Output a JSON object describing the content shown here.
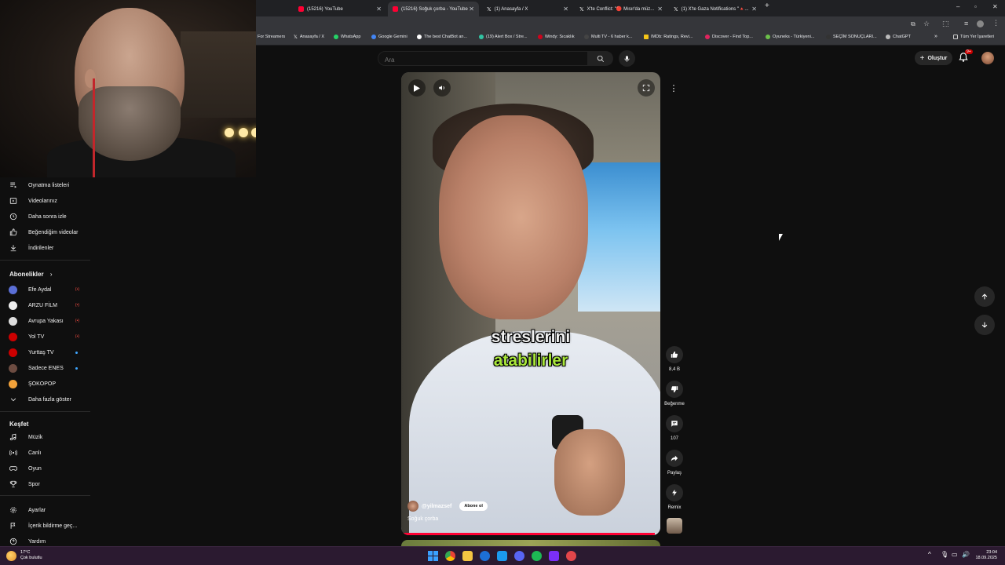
{
  "browser": {
    "tabs": [
      {
        "title": "(15216) YouTube",
        "active": false,
        "fav_color": "#ff0033"
      },
      {
        "title": "(15216) Soğuk çorba - YouTube",
        "active": true,
        "fav_color": "#ff0033"
      },
      {
        "title": "(1) Anasayfa / X",
        "active": false,
        "fav_color": "#ffffff"
      },
      {
        "title": "X'te Conflict: \"🔴 Mısır'da müz...",
        "active": false,
        "fav_color": "#ffffff"
      },
      {
        "title": "(1) X'te Gaza Notifications \"🔺...",
        "active": false,
        "fav_color": "#ffffff"
      }
    ],
    "new_tab": "+",
    "window_controls": [
      "–",
      "▫",
      "✕"
    ],
    "bookmarks": [
      {
        "label": "For Streamers",
        "color": "#9146ff"
      },
      {
        "label": "Anasayfa / X",
        "color": "#ffffff"
      },
      {
        "label": "WhatsApp",
        "color": "#25d366"
      },
      {
        "label": "Google Gemini",
        "color": "#4285f4"
      },
      {
        "label": "The best ChatBot an...",
        "color": "#ffffff"
      },
      {
        "label": "(19) Alert Box / Stre...",
        "color": "#31c3a2"
      },
      {
        "label": "Windy: Sıcaklık",
        "color": "#d0021b"
      },
      {
        "label": "Multi TV - 6 haber k...",
        "color": "#444444"
      },
      {
        "label": "IMDb: Ratings, Revi...",
        "color": "#f5c518"
      },
      {
        "label": "Discover - Find Top...",
        "color": "#e0245e"
      },
      {
        "label": "Oyuneks - Türkiyeni...",
        "color": "#6cc04a"
      },
      {
        "label": "SEÇİM SONUÇLARI...",
        "color": "#333333"
      },
      {
        "label": "ChatGPT",
        "color": "#bbbbbb"
      }
    ],
    "bookmarks_more": "»",
    "all_bookmarks": "Tüm Yer İşaretleri"
  },
  "header": {
    "search_placeholder": "Ara",
    "create_label": "Oluştur",
    "notif_badge": "9+"
  },
  "sidebar": {
    "you_items": [
      {
        "label": "Oynatma listeleri",
        "icon": "playlist-icon"
      },
      {
        "label": "Videolarınız",
        "icon": "your-videos-icon"
      },
      {
        "label": "Daha sonra izle",
        "icon": "clock-icon"
      },
      {
        "label": "Beğendiğim videolar",
        "icon": "thumbs-up-icon"
      },
      {
        "label": "İndirilenler",
        "icon": "download-icon"
      }
    ],
    "subscriptions_title": "Abonelikler",
    "subscriptions": [
      {
        "name": "Efe Aydal",
        "color": "#5b6fd6",
        "status": "live",
        "live_text": "(•)"
      },
      {
        "name": "ARZU FİLM",
        "color": "#eeeeee",
        "status": "live",
        "live_text": "(•)"
      },
      {
        "name": "Avrupa Yakası",
        "color": "#dddddd",
        "status": "live",
        "live_text": "(•)"
      },
      {
        "name": "Yol TV",
        "color": "#cc0000",
        "status": "live",
        "live_text": "(•)"
      },
      {
        "name": "Yurttaş TV",
        "color": "#cc0000",
        "status": "new",
        "live_text": ""
      },
      {
        "name": "Sadece ENES",
        "color": "#6d4c41",
        "status": "new",
        "live_text": ""
      },
      {
        "name": "ŞOKOPOP",
        "color": "#f2a23a",
        "status": "",
        "live_text": ""
      }
    ],
    "show_more": "Daha fazla göster",
    "explore_title": "Keşfet",
    "explore_items": [
      {
        "label": "Müzik",
        "icon": "music-icon"
      },
      {
        "label": "Canlı",
        "icon": "live-icon"
      },
      {
        "label": "Oyun",
        "icon": "gaming-icon"
      },
      {
        "label": "Spor",
        "icon": "trophy-icon"
      }
    ],
    "settings_items": [
      {
        "label": "Ayarlar",
        "icon": "gear-icon"
      },
      {
        "label": "İçerik bildirme geç...",
        "icon": "flag-icon"
      },
      {
        "label": "Yardım",
        "icon": "help-icon"
      }
    ]
  },
  "short": {
    "caption_line1": "streslerini",
    "caption_line2": "atabilirler",
    "caption_color1": "#ffffff",
    "caption_color2": "#a8e63a",
    "channel": "@yilmazsef",
    "subscribe_label": "Abone ol",
    "title": "Soğuk çorba",
    "progress": 0.98,
    "likes": "8,4 B",
    "dislike_label": "Beğenme",
    "comments": "107",
    "share_label": "Paylaş",
    "remix_label": "Remix"
  },
  "taskbar": {
    "temp": "17°C",
    "weather": "Çok bulutlu",
    "time": "23:04",
    "date": "18.09.2025"
  }
}
